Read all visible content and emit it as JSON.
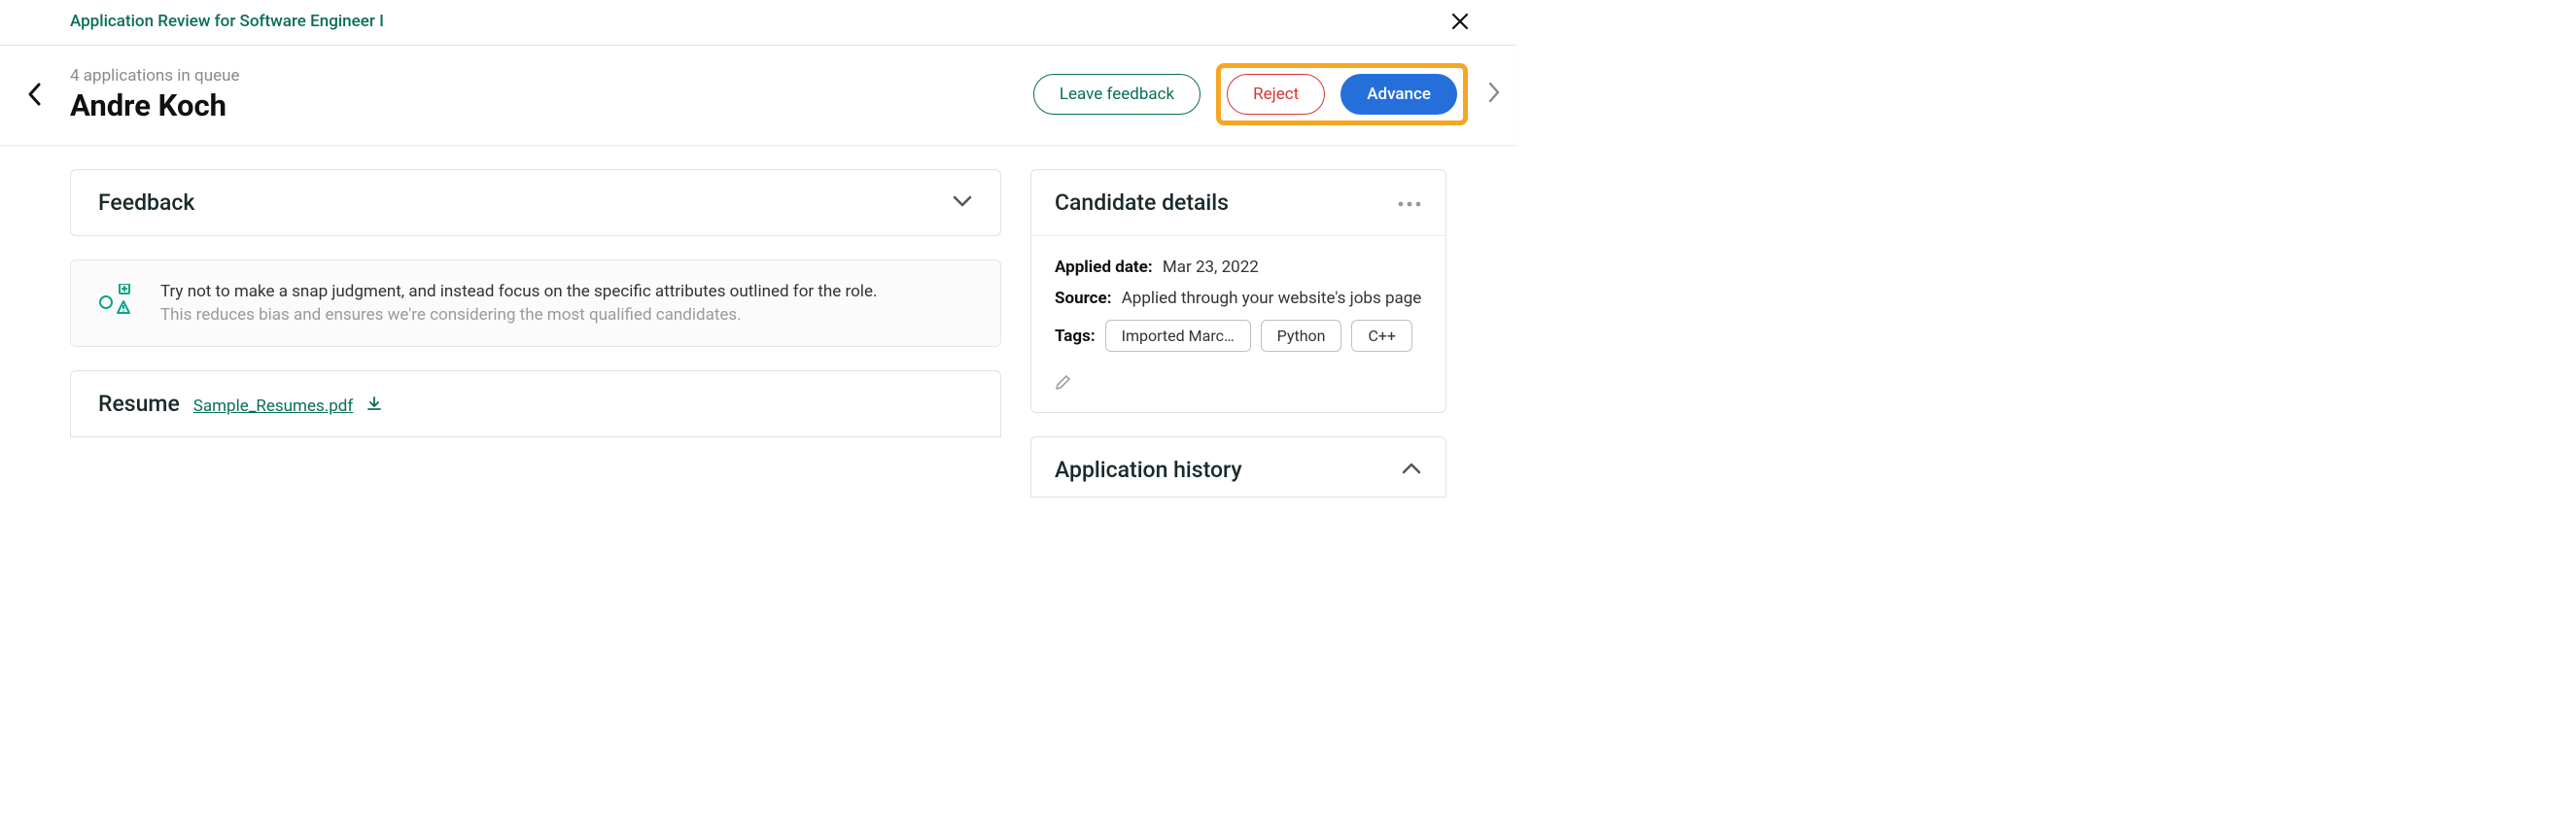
{
  "page_title": "Application Review for Software Engineer I",
  "queue_label": "4 applications in queue",
  "candidate_name": "Andre Koch",
  "actions": {
    "leave_feedback": "Leave feedback",
    "reject": "Reject",
    "advance": "Advance"
  },
  "feedback_section": {
    "title": "Feedback"
  },
  "info_banner": {
    "line1": "Try not to make a snap judgment, and instead focus on the specific attributes outlined for the role.",
    "line2": "This reduces bias and ensures we're considering the most qualified candidates."
  },
  "resume_section": {
    "title": "Resume",
    "file_name": "Sample_Resumes.pdf"
  },
  "candidate_details": {
    "title": "Candidate details",
    "applied_date_label": "Applied date:",
    "applied_date_value": "Mar 23, 2022",
    "source_label": "Source:",
    "source_value": "Applied through your website's jobs page",
    "tags_label": "Tags:",
    "tags": [
      "Imported Marc…",
      "Python",
      "C++"
    ]
  },
  "application_history": {
    "title": "Application history"
  }
}
